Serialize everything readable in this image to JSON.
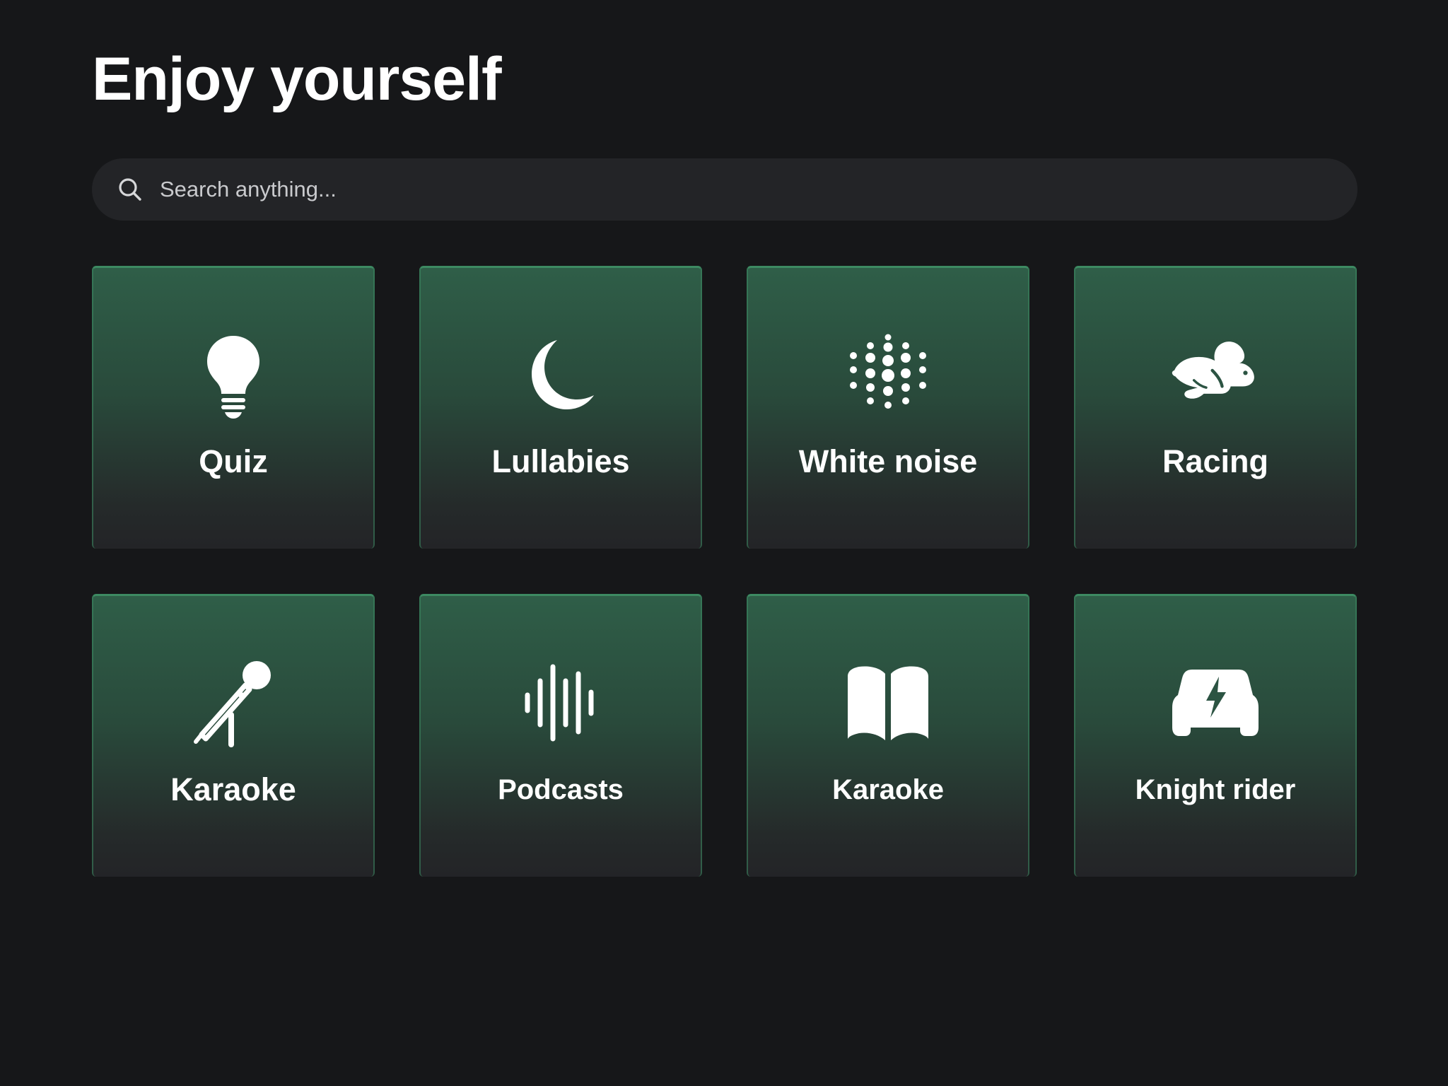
{
  "header": {
    "title": "Enjoy yourself"
  },
  "search": {
    "placeholder": "Search anything...",
    "icon": "search-icon"
  },
  "tiles": [
    {
      "label": "Quiz",
      "icon": "lightbulb-icon"
    },
    {
      "label": "Lullabies",
      "icon": "moon-icon"
    },
    {
      "label": "White noise",
      "icon": "white-noise-dots-icon"
    },
    {
      "label": "Racing",
      "icon": "rabbit-icon"
    },
    {
      "label": "Karaoke",
      "icon": "microphone-icon"
    },
    {
      "label": "Podcasts",
      "icon": "soundwave-icon"
    },
    {
      "label": "Karaoke",
      "icon": "book-icon"
    },
    {
      "label": "Knight rider",
      "icon": "electric-car-icon"
    }
  ],
  "colors": {
    "background": "#161719",
    "search_background": "#232427",
    "tile_top": "#2f5e48",
    "tile_bottom": "#232427",
    "tile_border": "#3d8a62"
  }
}
